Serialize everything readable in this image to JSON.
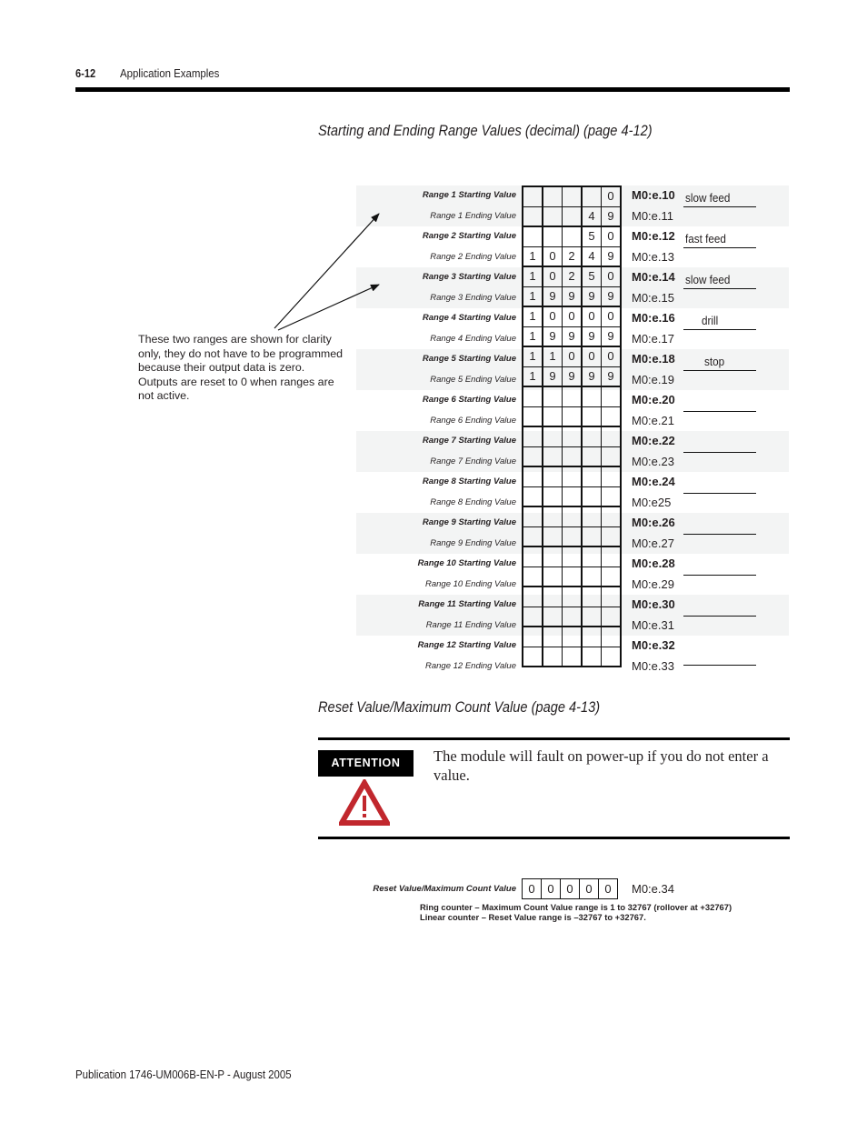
{
  "header": {
    "page_number": "6-12",
    "chapter_title": "Application Examples"
  },
  "range_section": {
    "title": "Starting and Ending Range Values (decimal) (page 4-12)",
    "ranges": [
      {
        "start_label": "Range 1 Starting Value",
        "end_label": "Range 1 Ending Value",
        "start_digits": [
          "",
          "",
          "",
          "",
          "0"
        ],
        "end_digits": [
          "",
          "",
          "",
          "4",
          "9"
        ],
        "start_addr": "M0:e.10",
        "end_addr": "M0:e.11",
        "output": "slow feed",
        "shaded": true
      },
      {
        "start_label": "Range 2 Starting Value",
        "end_label": "Range 2 Ending Value",
        "start_digits": [
          "",
          "",
          "",
          "5",
          "0"
        ],
        "end_digits": [
          "1",
          "0",
          "2",
          "4",
          "9"
        ],
        "start_addr": "M0:e.12",
        "end_addr": "M0:e.13",
        "output": "fast feed",
        "shaded": false
      },
      {
        "start_label": "Range 3 Starting Value",
        "end_label": "Range 3 Ending Value",
        "start_digits": [
          "1",
          "0",
          "2",
          "5",
          "0"
        ],
        "end_digits": [
          "1",
          "9",
          "9",
          "9",
          "9"
        ],
        "start_addr": "M0:e.14",
        "end_addr": "M0:e.15",
        "output": "slow feed",
        "shaded": true
      },
      {
        "start_label": "Range 4 Starting Value",
        "end_label": "Range 4 Ending Value",
        "start_digits": [
          "1",
          "0",
          "0",
          "0",
          "0"
        ],
        "end_digits": [
          "1",
          "9",
          "9",
          "9",
          "9"
        ],
        "start_addr": "M0:e.16",
        "end_addr": "M0:e.17",
        "output": "drill",
        "shaded": false
      },
      {
        "start_label": "Range 5 Starting Value",
        "end_label": "Range 5 Ending Value",
        "start_digits": [
          "1",
          "1",
          "0",
          "0",
          "0"
        ],
        "end_digits": [
          "1",
          "9",
          "9",
          "9",
          "9"
        ],
        "start_addr": "M0:e.18",
        "end_addr": "M0:e.19",
        "output": "stop",
        "shaded": true
      },
      {
        "start_label": "Range 6 Starting Value",
        "end_label": "Range 6 Ending Value",
        "start_digits": [
          "",
          "",
          "",
          "",
          ""
        ],
        "end_digits": [
          "",
          "",
          "",
          "",
          ""
        ],
        "start_addr": "M0:e.20",
        "end_addr": "M0:e.21",
        "output": "",
        "shaded": false
      },
      {
        "start_label": "Range 7 Starting Value",
        "end_label": "Range 7 Ending Value",
        "start_digits": [
          "",
          "",
          "",
          "",
          ""
        ],
        "end_digits": [
          "",
          "",
          "",
          "",
          ""
        ],
        "start_addr": "M0:e.22",
        "end_addr": "M0:e.23",
        "output": "",
        "shaded": true
      },
      {
        "start_label": "Range 8 Starting Value",
        "end_label": "Range 8 Ending Value",
        "start_digits": [
          "",
          "",
          "",
          "",
          ""
        ],
        "end_digits": [
          "",
          "",
          "",
          "",
          ""
        ],
        "start_addr": "M0:e.24",
        "end_addr": "M0:e25",
        "output": "",
        "shaded": false
      },
      {
        "start_label": "Range 9 Starting Value",
        "end_label": "Range 9 Ending Value",
        "start_digits": [
          "",
          "",
          "",
          "",
          ""
        ],
        "end_digits": [
          "",
          "",
          "",
          "",
          ""
        ],
        "start_addr": "M0:e.26",
        "end_addr": "M0:e.27",
        "output": "",
        "shaded": true
      },
      {
        "start_label": "Range 10 Starting Value",
        "end_label": "Range 10 Ending Value",
        "start_digits": [
          "",
          "",
          "",
          "",
          ""
        ],
        "end_digits": [
          "",
          "",
          "",
          "",
          ""
        ],
        "start_addr": "M0:e.28",
        "end_addr": "M0:e.29",
        "output": "",
        "shaded": false
      },
      {
        "start_label": "Range 11 Starting Value",
        "end_label": "Range 11 Ending Value",
        "start_digits": [
          "",
          "",
          "",
          "",
          ""
        ],
        "end_digits": [
          "",
          "",
          "",
          "",
          ""
        ],
        "start_addr": "M0:e.30",
        "end_addr": "M0:e.31",
        "output": "",
        "shaded": true
      },
      {
        "start_label": "Range 12 Starting Value",
        "end_label": "Range 12 Ending Value",
        "start_digits": [
          "",
          "",
          "",
          "",
          ""
        ],
        "end_digits": [
          "",
          "",
          "",
          "",
          ""
        ],
        "start_addr": "M0:e.32",
        "end_addr": "M0:e.33",
        "output": "",
        "shaded": false
      }
    ],
    "callout_note": "These two ranges are shown for clarity only, they do not have to be programmed because their output data is zero.  Outputs are reset to 0 when ranges are not active."
  },
  "reset_section": {
    "title": "Reset Value/Maximum Count Value (page 4-13)",
    "attention": {
      "badge": "ATTENTION",
      "icon": "warning-triangle-icon",
      "text": "The module will fault on power-up if you do not enter a value.",
      "icon_color": "#c1272d"
    },
    "label": "Reset Value/Maximum Count Value",
    "digits": [
      "0",
      "0",
      "0",
      "0",
      "0"
    ],
    "address": "M0:e.34",
    "notes": [
      "Ring counter – Maximum Count Value range is 1 to 32767  (rollover at +32767)",
      "Linear counter – Reset Value range is –32767 to +32767."
    ]
  },
  "footer": {
    "publication": "Publication 1746-UM006B-EN-P - August 2005"
  }
}
